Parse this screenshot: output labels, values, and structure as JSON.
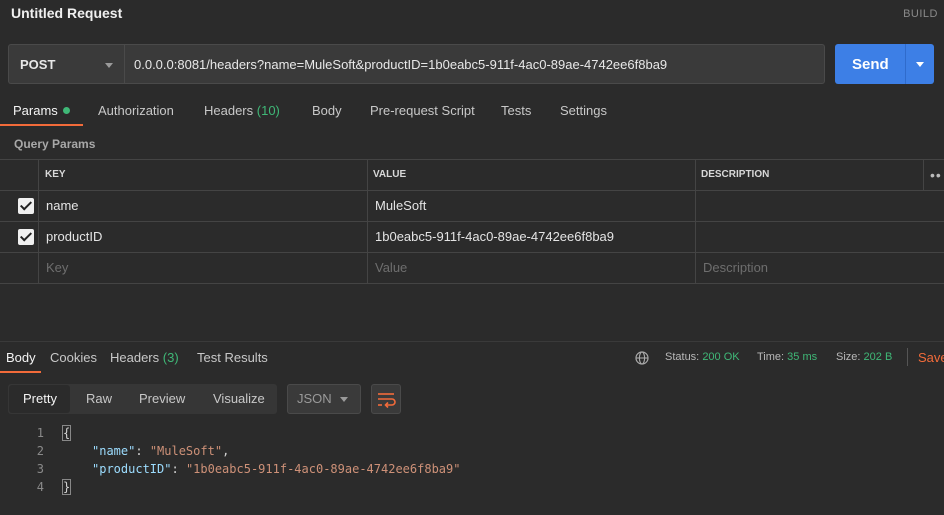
{
  "header": {
    "title": "Untitled Request",
    "build_label": "BUILD"
  },
  "request": {
    "method": "POST",
    "url": "0.0.0.0:8081/headers?name=MuleSoft&productID=1b0eabc5-911f-4ac0-89ae-4742ee6f8ba9",
    "send_label": "Send"
  },
  "tabs": {
    "params": "Params",
    "authorization": "Authorization",
    "headers": "Headers",
    "headers_count": "(10)",
    "body": "Body",
    "prerequest": "Pre-request Script",
    "tests": "Tests",
    "settings": "Settings"
  },
  "query_params": {
    "title": "Query Params",
    "columns": {
      "key": "KEY",
      "value": "VALUE",
      "description": "DESCRIPTION"
    },
    "rows": [
      {
        "key": "name",
        "value": "MuleSoft",
        "checked": true
      },
      {
        "key": "productID",
        "value": "1b0eabc5-911f-4ac0-89ae-4742ee6f8ba9",
        "checked": true
      }
    ],
    "placeholders": {
      "key": "Key",
      "value": "Value",
      "description": "Description"
    }
  },
  "response": {
    "tabs": {
      "body": "Body",
      "cookies": "Cookies",
      "headers": "Headers",
      "headers_count": "(3)",
      "test_results": "Test Results"
    },
    "status_label": "Status:",
    "status_value": "200 OK",
    "time_label": "Time:",
    "time_value": "35 ms",
    "size_label": "Size:",
    "size_value": "202 B",
    "save_label": "Save",
    "formats": {
      "pretty": "Pretty",
      "raw": "Raw",
      "preview": "Preview",
      "visualize": "Visualize"
    },
    "language": "JSON",
    "line_numbers": [
      "1",
      "2",
      "3",
      "4"
    ],
    "json": {
      "open_brace": "{",
      "close_brace": "}",
      "key1": "\"name\"",
      "val1": "\"MuleSoft\"",
      "key2": "\"productID\"",
      "val2": "\"1b0eabc5-911f-4ac0-89ae-4742ee6f8ba9\""
    }
  },
  "colors": {
    "accent": "#f26b3a",
    "send": "#3d7fe6",
    "status_ok": "#3fb877"
  }
}
